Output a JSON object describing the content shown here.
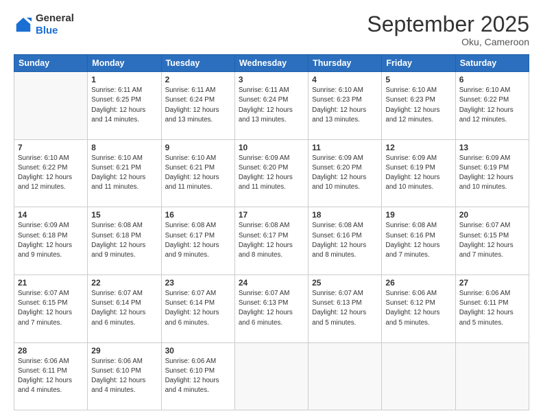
{
  "logo": {
    "general": "General",
    "blue": "Blue"
  },
  "header": {
    "month": "September 2025",
    "location": "Oku, Cameroon"
  },
  "weekdays": [
    "Sunday",
    "Monday",
    "Tuesday",
    "Wednesday",
    "Thursday",
    "Friday",
    "Saturday"
  ],
  "weeks": [
    [
      {
        "day": "",
        "text": ""
      },
      {
        "day": "1",
        "text": "Sunrise: 6:11 AM\nSunset: 6:25 PM\nDaylight: 12 hours\nand 14 minutes."
      },
      {
        "day": "2",
        "text": "Sunrise: 6:11 AM\nSunset: 6:24 PM\nDaylight: 12 hours\nand 13 minutes."
      },
      {
        "day": "3",
        "text": "Sunrise: 6:11 AM\nSunset: 6:24 PM\nDaylight: 12 hours\nand 13 minutes."
      },
      {
        "day": "4",
        "text": "Sunrise: 6:10 AM\nSunset: 6:23 PM\nDaylight: 12 hours\nand 13 minutes."
      },
      {
        "day": "5",
        "text": "Sunrise: 6:10 AM\nSunset: 6:23 PM\nDaylight: 12 hours\nand 12 minutes."
      },
      {
        "day": "6",
        "text": "Sunrise: 6:10 AM\nSunset: 6:22 PM\nDaylight: 12 hours\nand 12 minutes."
      }
    ],
    [
      {
        "day": "7",
        "text": "Sunrise: 6:10 AM\nSunset: 6:22 PM\nDaylight: 12 hours\nand 12 minutes."
      },
      {
        "day": "8",
        "text": "Sunrise: 6:10 AM\nSunset: 6:21 PM\nDaylight: 12 hours\nand 11 minutes."
      },
      {
        "day": "9",
        "text": "Sunrise: 6:10 AM\nSunset: 6:21 PM\nDaylight: 12 hours\nand 11 minutes."
      },
      {
        "day": "10",
        "text": "Sunrise: 6:09 AM\nSunset: 6:20 PM\nDaylight: 12 hours\nand 11 minutes."
      },
      {
        "day": "11",
        "text": "Sunrise: 6:09 AM\nSunset: 6:20 PM\nDaylight: 12 hours\nand 10 minutes."
      },
      {
        "day": "12",
        "text": "Sunrise: 6:09 AM\nSunset: 6:19 PM\nDaylight: 12 hours\nand 10 minutes."
      },
      {
        "day": "13",
        "text": "Sunrise: 6:09 AM\nSunset: 6:19 PM\nDaylight: 12 hours\nand 10 minutes."
      }
    ],
    [
      {
        "day": "14",
        "text": "Sunrise: 6:09 AM\nSunset: 6:18 PM\nDaylight: 12 hours\nand 9 minutes."
      },
      {
        "day": "15",
        "text": "Sunrise: 6:08 AM\nSunset: 6:18 PM\nDaylight: 12 hours\nand 9 minutes."
      },
      {
        "day": "16",
        "text": "Sunrise: 6:08 AM\nSunset: 6:17 PM\nDaylight: 12 hours\nand 9 minutes."
      },
      {
        "day": "17",
        "text": "Sunrise: 6:08 AM\nSunset: 6:17 PM\nDaylight: 12 hours\nand 8 minutes."
      },
      {
        "day": "18",
        "text": "Sunrise: 6:08 AM\nSunset: 6:16 PM\nDaylight: 12 hours\nand 8 minutes."
      },
      {
        "day": "19",
        "text": "Sunrise: 6:08 AM\nSunset: 6:16 PM\nDaylight: 12 hours\nand 7 minutes."
      },
      {
        "day": "20",
        "text": "Sunrise: 6:07 AM\nSunset: 6:15 PM\nDaylight: 12 hours\nand 7 minutes."
      }
    ],
    [
      {
        "day": "21",
        "text": "Sunrise: 6:07 AM\nSunset: 6:15 PM\nDaylight: 12 hours\nand 7 minutes."
      },
      {
        "day": "22",
        "text": "Sunrise: 6:07 AM\nSunset: 6:14 PM\nDaylight: 12 hours\nand 6 minutes."
      },
      {
        "day": "23",
        "text": "Sunrise: 6:07 AM\nSunset: 6:14 PM\nDaylight: 12 hours\nand 6 minutes."
      },
      {
        "day": "24",
        "text": "Sunrise: 6:07 AM\nSunset: 6:13 PM\nDaylight: 12 hours\nand 6 minutes."
      },
      {
        "day": "25",
        "text": "Sunrise: 6:07 AM\nSunset: 6:13 PM\nDaylight: 12 hours\nand 5 minutes."
      },
      {
        "day": "26",
        "text": "Sunrise: 6:06 AM\nSunset: 6:12 PM\nDaylight: 12 hours\nand 5 minutes."
      },
      {
        "day": "27",
        "text": "Sunrise: 6:06 AM\nSunset: 6:11 PM\nDaylight: 12 hours\nand 5 minutes."
      }
    ],
    [
      {
        "day": "28",
        "text": "Sunrise: 6:06 AM\nSunset: 6:11 PM\nDaylight: 12 hours\nand 4 minutes."
      },
      {
        "day": "29",
        "text": "Sunrise: 6:06 AM\nSunset: 6:10 PM\nDaylight: 12 hours\nand 4 minutes."
      },
      {
        "day": "30",
        "text": "Sunrise: 6:06 AM\nSunset: 6:10 PM\nDaylight: 12 hours\nand 4 minutes."
      },
      {
        "day": "",
        "text": ""
      },
      {
        "day": "",
        "text": ""
      },
      {
        "day": "",
        "text": ""
      },
      {
        "day": "",
        "text": ""
      }
    ]
  ]
}
